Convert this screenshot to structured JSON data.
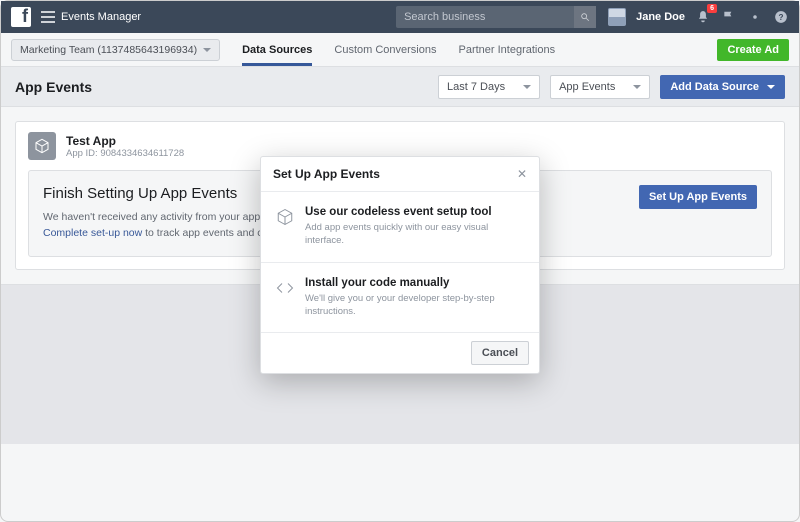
{
  "topbar": {
    "product": "Events Manager",
    "search_placeholder": "Search business",
    "user_name": "Jane Doe",
    "notification_count": "6"
  },
  "subbar": {
    "account_label": "Marketing Team (1137485643196934)",
    "tabs": [
      "Data Sources",
      "Custom Conversions",
      "Partner Integrations"
    ],
    "create_ad": "Create Ad"
  },
  "page": {
    "title": "App Events",
    "date_range": "Last 7 Days",
    "type_filter": "App Events",
    "add_source": "Add Data Source"
  },
  "app": {
    "name": "Test App",
    "id_label": "App ID: 9084334634611728"
  },
  "setup_panel": {
    "title": "Finish Setting Up App Events",
    "desc_prefix": "We haven't received any activity from your app.",
    "link_text": "Complete set-up now",
    "desc_suffix": " to track app events and create audiences f",
    "button": "Set Up App Events"
  },
  "modal": {
    "title": "Set Up App Events",
    "options": [
      {
        "title": "Use our codeless event setup tool",
        "desc": "Add app events quickly with our easy visual interface."
      },
      {
        "title": "Install your code manually",
        "desc": "We'll give you or your developer step-by-step instructions."
      }
    ],
    "cancel": "Cancel"
  }
}
